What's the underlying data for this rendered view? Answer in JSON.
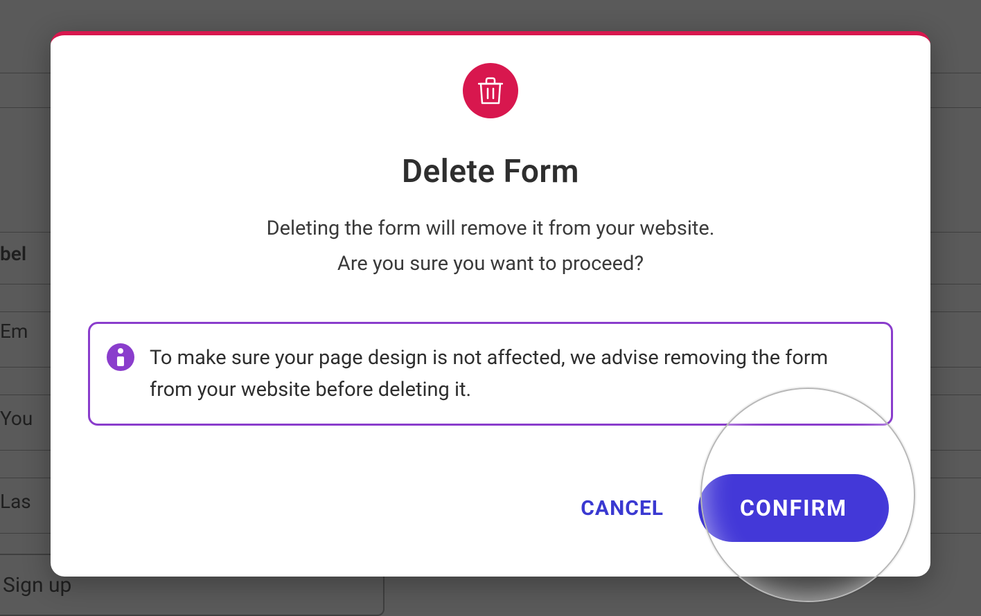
{
  "background": {
    "label_partial": "bel",
    "field_email": "Em",
    "field_you": "You",
    "field_last": "Las",
    "signup_button": "Sign up"
  },
  "modal": {
    "title": "Delete Form",
    "body_line1": "Deleting the form will remove it from your website.",
    "body_line2": "Are you sure you want to proceed?",
    "info_text": "To make sure your page design is not affected, we advise removing the form from your website before deleting it.",
    "cancel_label": "CANCEL",
    "confirm_label": "CONFIRM"
  },
  "colors": {
    "accent_red": "#d8174e",
    "accent_purple": "#8a3dcc",
    "primary_blue": "#4338d8"
  }
}
